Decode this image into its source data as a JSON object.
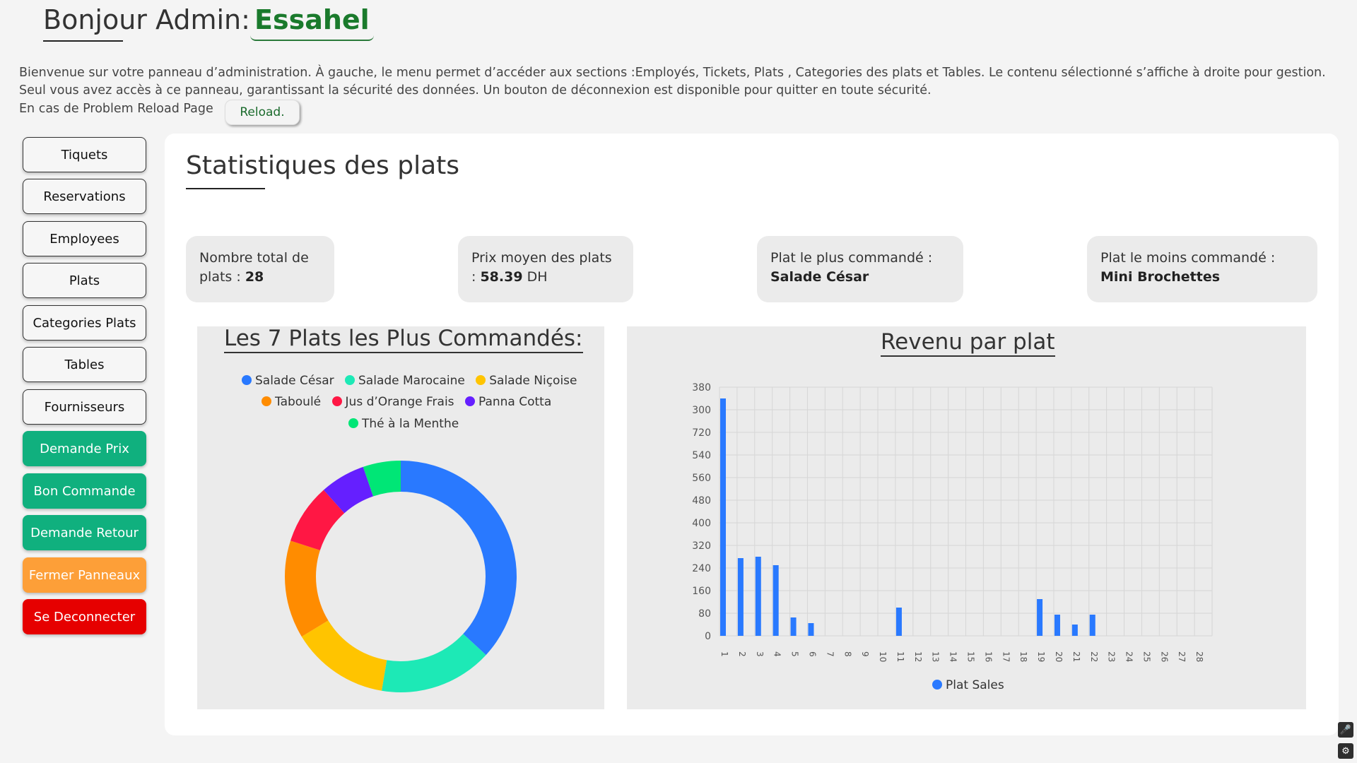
{
  "header": {
    "greeting": "Bonjour Admin:",
    "admin_name": "Essahel",
    "intro_line1": "Bienvenue sur votre panneau d’administration. À gauche, le menu permet d’accéder aux sections :Employés, Tickets, Plats , Categories des plats et Tables. Le contenu sélectionné s’affiche à droite pour gestion.",
    "intro_line2": "Seul vous avez accès à ce panneau, garantissant la sécurité des données. Un bouton de déconnexion est disponible pour quitter en toute sécurité.",
    "reload_text": "En cas de Problem Reload Page",
    "reload_button": "Reload."
  },
  "sidebar": {
    "items": [
      {
        "label": "Tiquets",
        "style": "plain"
      },
      {
        "label": "Reservations",
        "style": "plain"
      },
      {
        "label": "Employees",
        "style": "plain"
      },
      {
        "label": "Plats",
        "style": "plain"
      },
      {
        "label": "Categories Plats",
        "style": "plain"
      },
      {
        "label": "Tables",
        "style": "plain"
      },
      {
        "label": "Fournisseurs",
        "style": "plain"
      },
      {
        "label": "Demande Prix",
        "style": "green"
      },
      {
        "label": "Bon Commande",
        "style": "green"
      },
      {
        "label": "Demande Retour",
        "style": "green"
      },
      {
        "label": "Fermer Panneaux",
        "style": "orange"
      },
      {
        "label": "Se Deconnecter",
        "style": "red"
      }
    ]
  },
  "main": {
    "title": "Statistiques des plats",
    "stats": {
      "total_label_a": "Nombre total de",
      "total_label_b": "plats :",
      "total_value": "28",
      "avg_label_a": "Prix moyen des plats",
      "avg_label_b": ":",
      "avg_value": "58.39",
      "avg_unit": "DH",
      "most_label": "Plat le plus commandé :",
      "most_value": "Salade César",
      "least_label": "Plat le moins commandé :",
      "least_value": "Mini Brochettes"
    }
  },
  "chart_data": [
    {
      "type": "pie",
      "donut": true,
      "title": "Les 7 Plats les Plus Commandés:",
      "categories": [
        "Salade César",
        "Salade Marocaine",
        "Salade Niçoise",
        "Taboulé",
        "Jus d’Orange Frais",
        "Panna Cotta",
        "Thé à la Menthe"
      ],
      "values": [
        35,
        15,
        13,
        13,
        8,
        6,
        5
      ],
      "colors": [
        "#2979ff",
        "#1de9b6",
        "#ffc400",
        "#ff8c00",
        "#ff1744",
        "#651fff",
        "#00e676"
      ],
      "legend": "top"
    },
    {
      "type": "bar",
      "title": "Revenu par plat",
      "categories": [
        "1",
        "2",
        "3",
        "4",
        "5",
        "6",
        "7",
        "8",
        "9",
        "10",
        "11",
        "12",
        "13",
        "14",
        "15",
        "16",
        "17",
        "18",
        "19",
        "20",
        "21",
        "22",
        "23",
        "24",
        "25",
        "26",
        "27",
        "28"
      ],
      "series": [
        {
          "name": "Plat Sales",
          "color": "#2979ff",
          "values": [
            840,
            275,
            280,
            250,
            65,
            45,
            0,
            0,
            0,
            0,
            100,
            0,
            0,
            0,
            0,
            0,
            0,
            0,
            130,
            75,
            40,
            75,
            0,
            0,
            0,
            0,
            0,
            0
          ]
        }
      ],
      "y_ticks": [
        "380",
        "300",
        "720",
        "540",
        "560",
        "480",
        "400",
        "320",
        "240",
        "160",
        "80",
        "0"
      ],
      "x_ticks": [
        "1",
        "2",
        "3",
        "4",
        "5",
        "6",
        "7",
        "8",
        "9",
        "10",
        "11",
        "12",
        "13",
        "14",
        "15",
        "16",
        "17",
        "18",
        "19",
        "20",
        "21",
        "22",
        "23",
        "24",
        "25",
        "26",
        "27",
        "28"
      ],
      "ylim": [
        0,
        880
      ],
      "grid": true,
      "legend": "bottom"
    }
  ]
}
